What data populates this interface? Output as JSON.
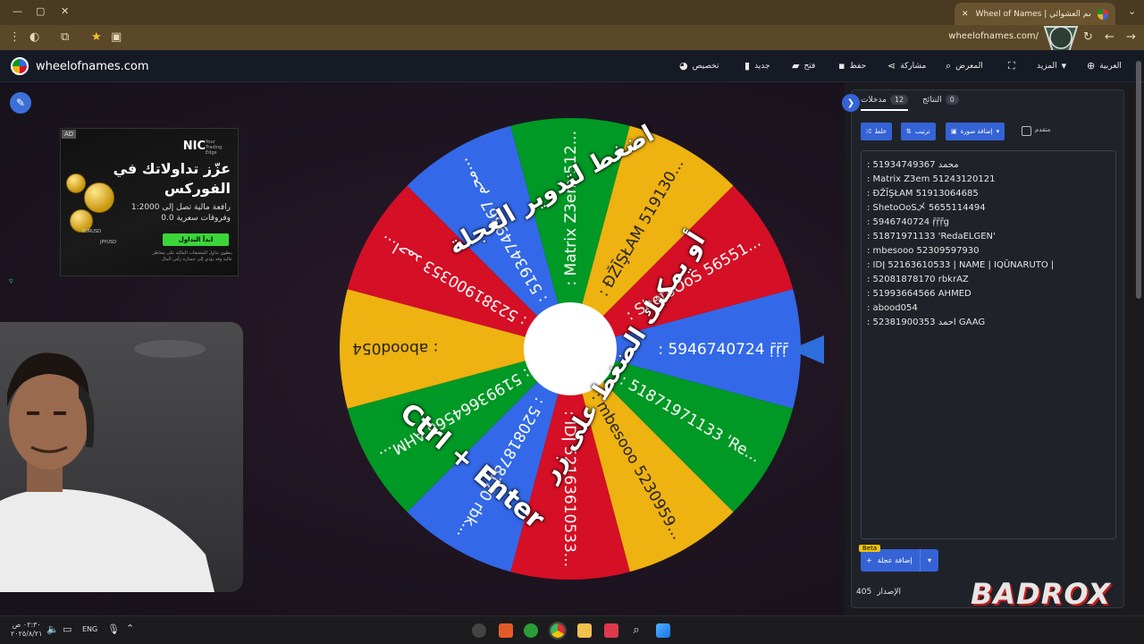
{
  "browser": {
    "tab_title": "Wheel of Names | سم العشوائي",
    "url": "wheelofnames.com/"
  },
  "header": {
    "brand": "wheelofnames.com",
    "menu": {
      "customize": "تخصيص",
      "new": "جديد",
      "open": "فتح",
      "save": "حفظ",
      "share": "مشاركة",
      "gallery": "المعرض",
      "more": "المزيد",
      "language": "العربية"
    }
  },
  "ad": {
    "tag": "AD",
    "brand": "NIC",
    "brand_sub": "Your Trading Edge",
    "headline_1": "عزّز تداولاتك في",
    "headline_2": "الفوركس",
    "body_1": "رافعة مالية تصل إلى 1:2000",
    "body_2": "وفروقات سعرية 0.0",
    "cta": "ابدأ التداول",
    "fine_print": "ينطوي تداول المشتقات المالية على مخاطر عالية وقد يؤدي إلى خسارة رأس المال",
    "pair_1": "EURUSD",
    "pair_2": "JPYUSD"
  },
  "wheel": {
    "colors": [
      "#3369e8",
      "#009925",
      "#eeb211",
      "#d50f25"
    ],
    "segments": [
      ": 5946740724 ṝṝṝ",
      ": 51871971133 'Re...",
      ": mbesooo 5230959...",
      ": IDǀ 52163610533...",
      ": 52081878170 rbk...",
      ": 51993664566 AHM...",
      ": abood054",
      ": 52381900353 احمد...",
      ": 51934749367 محم...",
      ": Matrix Z3em 512...",
      ": ĐŽĪŞŁAM 519130...",
      ": ShetoOoS 56551..."
    ],
    "overlay_line1": "اضغط لتدوير العجلة",
    "overlay_line2": "أو يمكنك الضغط على زر",
    "overlay_line3": "Ctrl + Enter"
  },
  "panel": {
    "tab_entries": "مدخلات",
    "entries_count": "12",
    "tab_results": "النتائج",
    "results_count": "0",
    "shuffle": "خلط",
    "sort": "ترتيب",
    "add_image": "إضافة صورة",
    "advanced": "متقدم",
    "entries": [
      ": 51934749367 محمد",
      ": Matrix Z3em 51243120121",
      ": ĐŽĪŞŁAM 51913064685",
      ": ShetoOoS乄 5655114494",
      ": 5946740724 ṝṝṝg",
      ": 51871971133 'RedaELGEN'",
      ": mbesooo 52309597930",
      ": IDǀ 52163610533 | NAME | IQŪNARUTO |",
      ": 52081878170 rbkrAZ",
      ": 51993664566 AHMED",
      ": abood054",
      ": 52381900353 احمد GAAG"
    ],
    "beta": "Beta",
    "add_wheel": "إضافة عجلة",
    "version_label": "الإصدار",
    "version_number": "405"
  },
  "overlay": {
    "watermark": "BADROX"
  },
  "taskbar": {
    "lang": "ENG",
    "time": "٠٢:٣٠ ص",
    "date": "٢٠٢٥/٨/٢١"
  }
}
